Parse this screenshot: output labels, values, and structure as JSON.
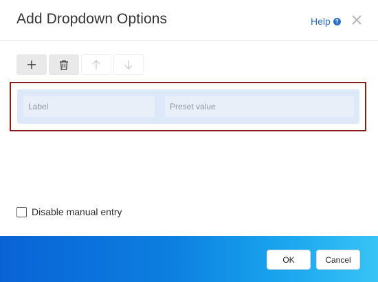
{
  "dialog": {
    "title": "Add Dropdown Options",
    "help_label": "Help",
    "help_icon_glyph": "?"
  },
  "toolbar": {
    "buttons": [
      {
        "name": "add-option-button",
        "icon": "plus-icon",
        "enabled": true
      },
      {
        "name": "delete-option-button",
        "icon": "trash-icon",
        "enabled": true
      },
      {
        "name": "move-up-button",
        "icon": "arrow-up-icon",
        "enabled": false
      },
      {
        "name": "move-down-button",
        "icon": "arrow-down-icon",
        "enabled": false
      }
    ]
  },
  "options": {
    "rows": [
      {
        "label_placeholder": "Label",
        "preset_placeholder": "Preset value",
        "label_value": "",
        "preset_value": ""
      }
    ]
  },
  "disable_manual_entry": {
    "label": "Disable manual entry",
    "checked": false
  },
  "footer": {
    "ok_label": "OK",
    "cancel_label": "Cancel"
  },
  "colors": {
    "accent": "#2b6fc8",
    "selection_frame": "#8b1a1a",
    "row_background": "#dde9f8",
    "footer_gradient_start": "#0a63d6",
    "footer_gradient_end": "#38c4f6"
  }
}
